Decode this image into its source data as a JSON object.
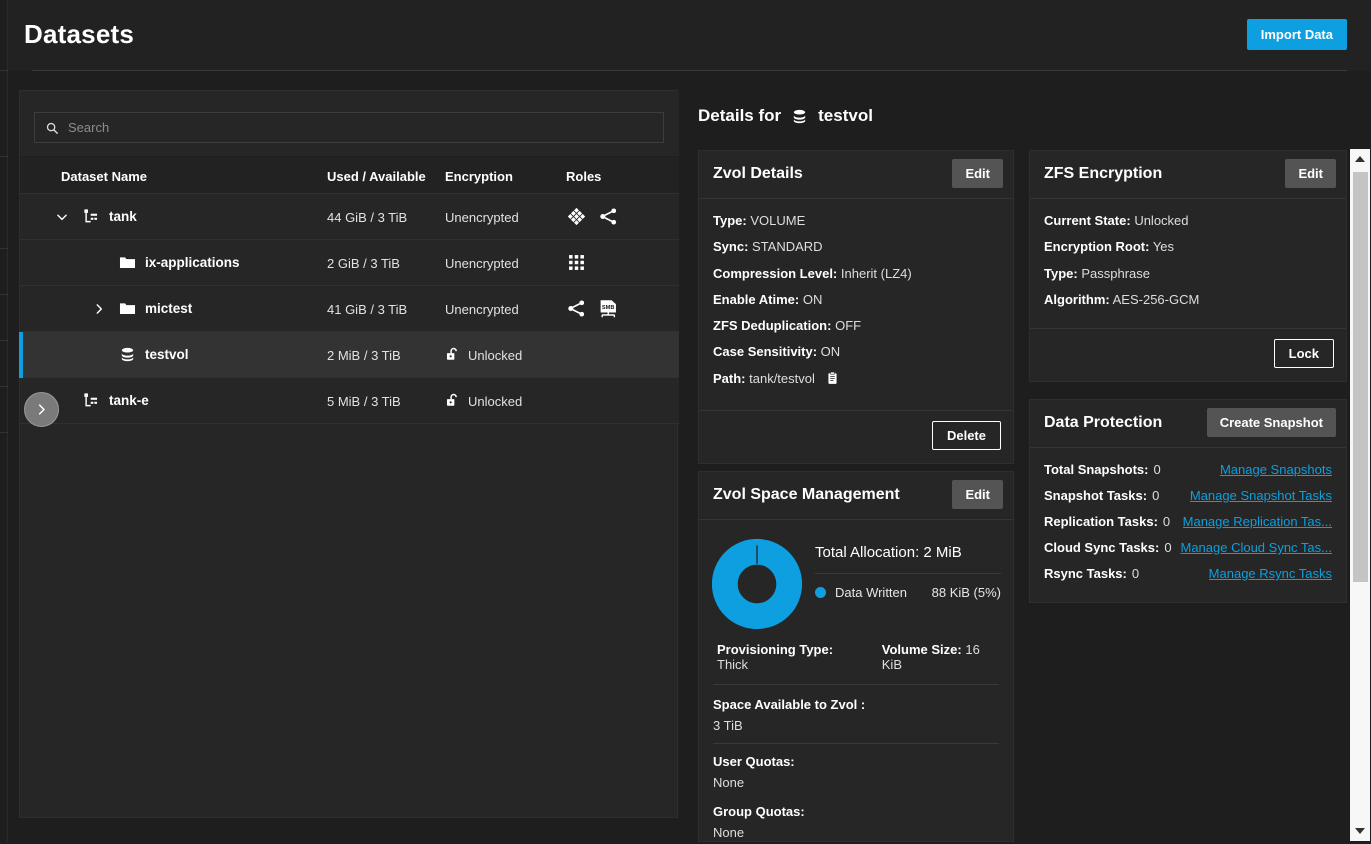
{
  "header": {
    "title": "Datasets",
    "import_button": "Import Data"
  },
  "search": {
    "placeholder": "Search",
    "value": ""
  },
  "tree": {
    "columns": {
      "name": "Dataset Name",
      "used": "Used / Available",
      "encryption": "Encryption",
      "roles": "Roles"
    },
    "rows": [
      {
        "name": "tank",
        "used": "44 GiB / 3 TiB",
        "encryption": "Unencrypted",
        "indent": 0,
        "icon": "dataset-root-icon",
        "expanded": true,
        "has_chevron": true,
        "selected": false,
        "roles": [
          "blocks-icon",
          "share-icon"
        ]
      },
      {
        "name": "ix-applications",
        "used": "2 GiB / 3 TiB",
        "encryption": "Unencrypted",
        "indent": 1,
        "icon": "folder-icon",
        "expanded": false,
        "has_chevron": false,
        "selected": false,
        "roles": [
          "apps-grid-icon"
        ]
      },
      {
        "name": "mictest",
        "used": "41 GiB / 3 TiB",
        "encryption": "Unencrypted",
        "indent": 1,
        "icon": "folder-icon",
        "expanded": false,
        "has_chevron": true,
        "selected": false,
        "roles": [
          "share-icon",
          "smb-share-icon"
        ]
      },
      {
        "name": "testvol",
        "used": "2 MiB / 3 TiB",
        "encryption": "Unlocked",
        "indent": 1,
        "icon": "zvol-icon",
        "expanded": false,
        "has_chevron": false,
        "selected": true,
        "roles": []
      },
      {
        "name": "tank-e",
        "used": "5 MiB / 3 TiB",
        "encryption": "Unlocked",
        "indent": 0,
        "icon": "dataset-root-icon",
        "expanded": false,
        "has_chevron": false,
        "selected": false,
        "roles": []
      }
    ]
  },
  "details": {
    "heading_prefix": "Details for",
    "heading_name": "testvol"
  },
  "zvol_details": {
    "title": "Zvol Details",
    "edit_label": "Edit",
    "delete_label": "Delete",
    "fields": [
      {
        "label": "Type:",
        "value": "VOLUME"
      },
      {
        "label": "Sync:",
        "value": "STANDARD"
      },
      {
        "label": "Compression Level:",
        "value": "Inherit (LZ4)"
      },
      {
        "label": "Enable Atime:",
        "value": "ON"
      },
      {
        "label": "ZFS Deduplication:",
        "value": "OFF"
      },
      {
        "label": "Case Sensitivity:",
        "value": "ON"
      },
      {
        "label": "Path:",
        "value": "tank/testvol"
      }
    ]
  },
  "zvol_space": {
    "title": "Zvol Space Management",
    "edit_label": "Edit",
    "total_allocation_label": "Total Allocation:",
    "total_allocation_value": "2 MiB",
    "provisioning_label": "Provisioning Type:",
    "provisioning_value": "Thick",
    "volume_size_label": "Volume Size:",
    "volume_size_value": "16 KiB",
    "space_available_label": "Space Available to Zvol :",
    "space_available_value": "3 TiB",
    "user_quotas_label": "User Quotas:",
    "user_quotas_value": "None",
    "group_quotas_label": "Group Quotas:",
    "group_quotas_value": "None"
  },
  "chart_data": {
    "type": "pie",
    "title": "Zvol Space Management",
    "subtitle": "Total Allocation: 2 MiB",
    "categories": [
      "Data Written"
    ],
    "values": [
      88
    ],
    "value_labels": [
      "88 KiB (5%)"
    ],
    "colors": [
      "#0d9fe0"
    ],
    "units": "KiB",
    "donut": true,
    "legend_position": "right",
    "total_label": "Total Allocation",
    "total_value": "2 MiB"
  },
  "encryption": {
    "title": "ZFS Encryption",
    "edit_label": "Edit",
    "lock_label": "Lock",
    "fields": [
      {
        "label": "Current State:",
        "value": "Unlocked"
      },
      {
        "label": "Encryption Root:",
        "value": "Yes"
      },
      {
        "label": "Type:",
        "value": "Passphrase"
      },
      {
        "label": "Algorithm:",
        "value": "AES-256-GCM"
      }
    ]
  },
  "protection": {
    "title": "Data Protection",
    "create_snapshot_label": "Create Snapshot",
    "rows": [
      {
        "label": "Total Snapshots:",
        "count": "0",
        "link": "Manage Snapshots"
      },
      {
        "label": "Snapshot Tasks:",
        "count": "0",
        "link": "Manage Snapshot Tasks"
      },
      {
        "label": "Replication Tasks:",
        "count": "0",
        "link": "Manage Replication Tas..."
      },
      {
        "label": "Cloud Sync Tasks:",
        "count": "0",
        "link": "Manage Cloud Sync Tas..."
      },
      {
        "label": "Rsync Tasks:",
        "count": "0",
        "link": "Manage Rsync Tasks"
      }
    ]
  },
  "colors": {
    "accent": "#0d9fe0",
    "page_bg": "#1e1e1e",
    "card_bg": "#262626",
    "header_bg": "#222222",
    "selected_row": "#333333"
  }
}
